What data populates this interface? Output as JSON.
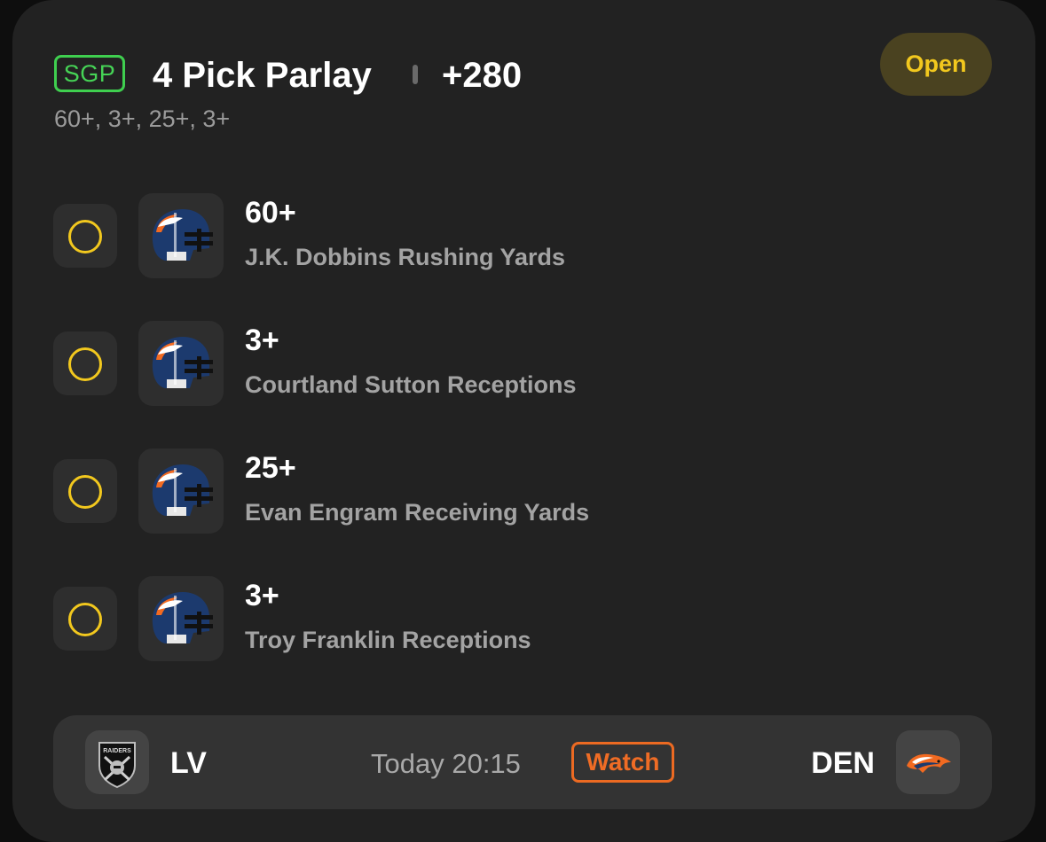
{
  "parlay": {
    "badge": "SGP",
    "title": "4 Pick Parlay",
    "odds": "+280",
    "summary": "60+, 3+, 25+, 3+",
    "status": "Open"
  },
  "legs": [
    {
      "line": "60+",
      "market": "J.K. Dobbins Rushing Yards",
      "icon": "broncos-helmet-icon"
    },
    {
      "line": "3+",
      "market": "Courtland Sutton Receptions",
      "icon": "broncos-helmet-icon"
    },
    {
      "line": "25+",
      "market": "Evan Engram Receiving Yards",
      "icon": "broncos-helmet-icon"
    },
    {
      "line": "3+",
      "market": "Troy Franklin Receptions",
      "icon": "broncos-helmet-icon"
    }
  ],
  "game": {
    "away": {
      "abbr": "LV",
      "logo": "raiders-logo-icon",
      "logo_text": "RAIDERS"
    },
    "home": {
      "abbr": "DEN",
      "logo": "broncos-logo-icon"
    },
    "time": "Today 20:15",
    "watch_label": "Watch"
  },
  "colors": {
    "card_bg": "#222222",
    "accent_green": "#46d456",
    "accent_yellow": "#f2c81e",
    "accent_orange": "#ef6c25",
    "broncos_navy": "#1c3a6e",
    "broncos_orange": "#f26a21"
  }
}
